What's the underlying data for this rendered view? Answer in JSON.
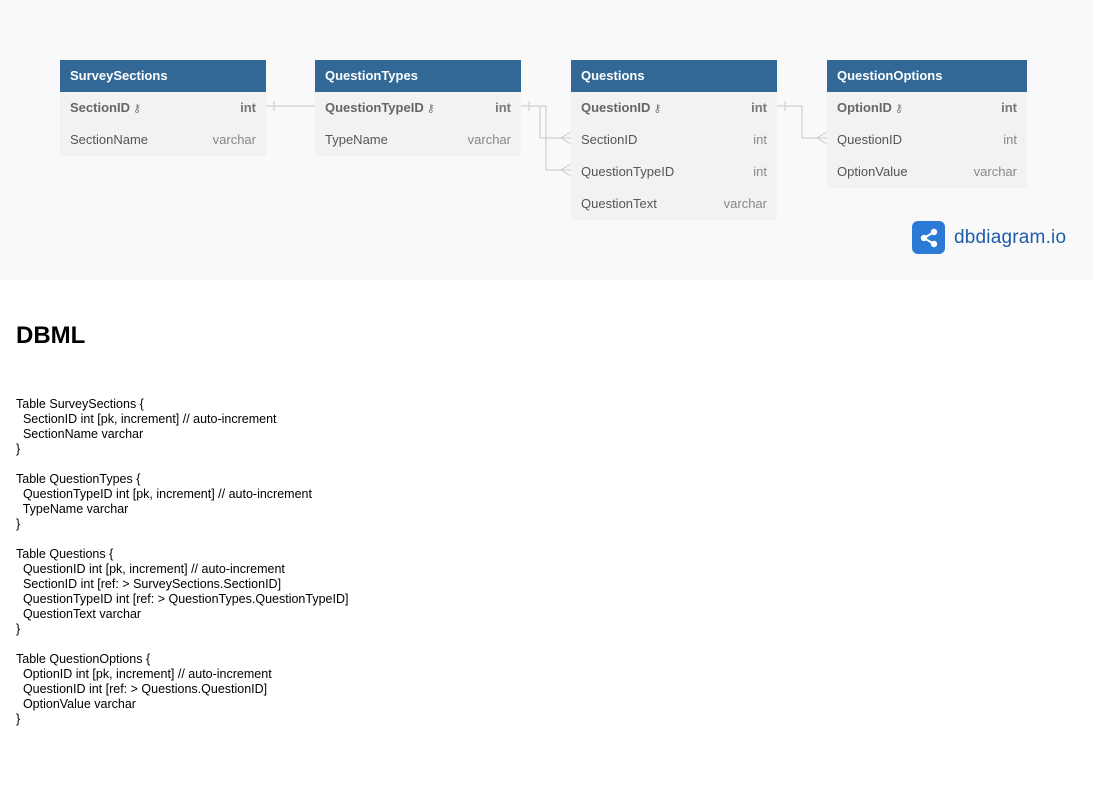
{
  "tables": [
    {
      "name": "SurveySections",
      "columns": [
        {
          "name": "SectionID",
          "type": "int",
          "pk": true
        },
        {
          "name": "SectionName",
          "type": "varchar",
          "pk": false
        }
      ]
    },
    {
      "name": "QuestionTypes",
      "columns": [
        {
          "name": "QuestionTypeID",
          "type": "int",
          "pk": true
        },
        {
          "name": "TypeName",
          "type": "varchar",
          "pk": false
        }
      ]
    },
    {
      "name": "Questions",
      "columns": [
        {
          "name": "QuestionID",
          "type": "int",
          "pk": true
        },
        {
          "name": "SectionID",
          "type": "int",
          "pk": false
        },
        {
          "name": "QuestionTypeID",
          "type": "int",
          "pk": false
        },
        {
          "name": "QuestionText",
          "type": "varchar",
          "pk": false
        }
      ]
    },
    {
      "name": "QuestionOptions",
      "columns": [
        {
          "name": "OptionID",
          "type": "int",
          "pk": true
        },
        {
          "name": "QuestionID",
          "type": "int",
          "pk": false
        },
        {
          "name": "OptionValue",
          "type": "varchar",
          "pk": false
        }
      ]
    }
  ],
  "relationships": [
    {
      "from": "SurveySections.SectionID",
      "to": "Questions.SectionID"
    },
    {
      "from": "QuestionTypes.QuestionTypeID",
      "to": "Questions.QuestionTypeID"
    },
    {
      "from": "Questions.QuestionID",
      "to": "QuestionOptions.QuestionID"
    }
  ],
  "logo": {
    "text": "dbdiagram.io",
    "icon": "share-nodes-icon"
  },
  "dbml": {
    "title": "DBML",
    "code": "Table SurveySections {\n  SectionID int [pk, increment] // auto-increment\n  SectionName varchar\n}\n\nTable QuestionTypes {\n  QuestionTypeID int [pk, increment] // auto-increment\n  TypeName varchar\n}\n\nTable Questions {\n  QuestionID int [pk, increment] // auto-increment\n  SectionID int [ref: > SurveySections.SectionID]\n  QuestionTypeID int [ref: > QuestionTypes.QuestionTypeID]\n  QuestionText varchar\n}\n\nTable QuestionOptions {\n  OptionID int [pk, increment] // auto-increment\n  QuestionID int [ref: > Questions.QuestionID]\n  OptionValue varchar\n}"
  },
  "colors": {
    "header": "#316896",
    "body": "#f2f2f2",
    "canvas": "#f9f9f9",
    "connector": "#c8c8c8",
    "logo": "#2a7ad6"
  }
}
